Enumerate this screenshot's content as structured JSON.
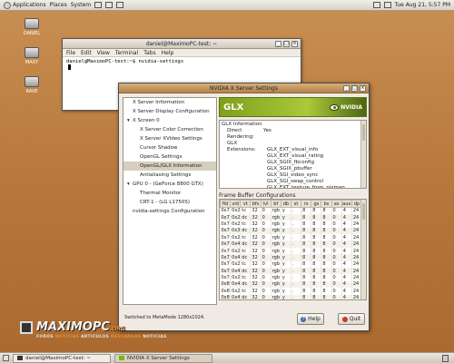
{
  "top_panel": {
    "menus": [
      "Applications",
      "Places",
      "System"
    ],
    "datetime": "Tue Aug 21,  5:57 PM"
  },
  "desktop_icons": [
    "DANIEL",
    "MAXY",
    "RAVE"
  ],
  "terminal": {
    "title": "daniel@MaximoPC-test: ~",
    "menu": [
      "File",
      "Edit",
      "View",
      "Terminal",
      "Tabs",
      "Help"
    ],
    "command_line": "daniel@MaximoPC-test:~$ nvidia-settings"
  },
  "nvidia": {
    "title": "NVIDIA X Server Settings",
    "nav": [
      {
        "label": "X Server Information",
        "level": 0,
        "expander": ""
      },
      {
        "label": "X Server Display Configuration",
        "level": 0,
        "expander": ""
      },
      {
        "label": "X Screen 0",
        "level": 0,
        "expander": "▾"
      },
      {
        "label": "X Server Color Correction",
        "level": 1,
        "expander": ""
      },
      {
        "label": "X Server XVideo Settings",
        "level": 1,
        "expander": ""
      },
      {
        "label": "Cursor Shadow",
        "level": 1,
        "expander": ""
      },
      {
        "label": "OpenGL Settings",
        "level": 1,
        "expander": ""
      },
      {
        "label": "OpenGL/GLX Information",
        "level": 1,
        "expander": "",
        "selected": true
      },
      {
        "label": "Antialiasing Settings",
        "level": 1,
        "expander": ""
      },
      {
        "label": "GPU 0 - (GeForce 8800 GTX)",
        "level": 0,
        "expander": "▾"
      },
      {
        "label": "Thermal Monitor",
        "level": 1,
        "expander": ""
      },
      {
        "label": "CRT-1 - (LG L1750S)",
        "level": 1,
        "expander": ""
      },
      {
        "label": "nvidia-settings Configuration",
        "level": 0,
        "expander": ""
      }
    ],
    "banner_title": "GLX",
    "banner_brand": "NVIDIA",
    "glx": {
      "heading": "GLX Information",
      "direct_rendering_label": "Direct Rendering:",
      "direct_rendering_value": "Yes",
      "extensions_label": "GLX Extensions:",
      "extensions": [
        "GLX_EXT_visual_info",
        "GLX_EXT_visual_rating",
        "GLX_SGIX_fbconfig",
        "GLX_SGIX_pbuffer",
        "GLX_SGI_video_sync",
        "GLX_SGI_swap_control",
        "GLX_EXT_texture_from_pixmap",
        "GLX_ARB_multisample"
      ]
    },
    "fbc": {
      "heading": "Frame Buffer Configurations",
      "columns": [
        "fid",
        "vid",
        "vt",
        "bfs",
        "lvl",
        "bf",
        "db",
        "st",
        "rs",
        "gs",
        "bs",
        "as",
        "aux",
        "dp"
      ],
      "rows": [
        [
          "0x75",
          "0x21",
          "tc",
          "32",
          "0",
          "rgb",
          "y",
          ".",
          "8",
          "8",
          "8",
          "0",
          "4",
          "24"
        ],
        [
          "0x76",
          "0x22",
          "dc",
          "32",
          "0",
          "rgb",
          "y",
          ".",
          "8",
          "8",
          "8",
          "0",
          "4",
          "24"
        ],
        [
          "0x77",
          "0x24",
          "tc",
          "32",
          "0",
          "rgb",
          "y",
          ".",
          "8",
          "8",
          "8",
          "0",
          "4",
          "24"
        ],
        [
          "0x78",
          "0x3f",
          "dc",
          "32",
          "0",
          "rgb",
          "y",
          ".",
          "8",
          "8",
          "8",
          "0",
          "4",
          "24"
        ],
        [
          "0x79",
          "0x25",
          "tc",
          "32",
          "0",
          "rgb",
          "y",
          ".",
          "8",
          "8",
          "8",
          "0",
          "4",
          "24"
        ],
        [
          "0x7a",
          "0x40",
          "dc",
          "32",
          "0",
          "rgb",
          "y",
          ".",
          "8",
          "8",
          "8",
          "0",
          "4",
          "24"
        ],
        [
          "0x7b",
          "0x26",
          "tc",
          "32",
          "0",
          "rgb",
          "y",
          ".",
          "8",
          "8",
          "8",
          "0",
          "4",
          "24"
        ],
        [
          "0x7c",
          "0x41",
          "dc",
          "32",
          "0",
          "rgb",
          "y",
          ".",
          "8",
          "8",
          "8",
          "0",
          "4",
          "24"
        ],
        [
          "0x7d",
          "0x27",
          "tc",
          "32",
          "0",
          "rgb",
          "y",
          ".",
          "8",
          "8",
          "8",
          "0",
          "4",
          "24"
        ],
        [
          "0x7e",
          "0x42",
          "dc",
          "32",
          "0",
          "rgb",
          "y",
          ".",
          "8",
          "8",
          "8",
          "0",
          "4",
          "24"
        ],
        [
          "0x7f",
          "0x28",
          "tc",
          "32",
          "0",
          "rgb",
          "y",
          ".",
          "8",
          "8",
          "8",
          "0",
          "4",
          "24"
        ],
        [
          "0x80",
          "0x43",
          "dc",
          "32",
          "0",
          "rgb",
          "y",
          ".",
          "8",
          "8",
          "8",
          "0",
          "4",
          "24"
        ],
        [
          "0x81",
          "0x29",
          "tc",
          "32",
          "0",
          "rgb",
          "y",
          ".",
          "8",
          "8",
          "8",
          "0",
          "4",
          "24"
        ],
        [
          "0x82",
          "0x44",
          "dc",
          "32",
          "0",
          "rgb",
          "y",
          ".",
          "8",
          "8",
          "8",
          "0",
          "4",
          "24"
        ],
        [
          "0x83",
          "0x2a",
          "tc",
          "32",
          "0",
          "rgb",
          "y",
          ".",
          "8",
          "8",
          "8",
          "0",
          "4",
          "24"
        ]
      ]
    },
    "status": "Switched to MetaMode 1280x1024.",
    "help_label": "Help",
    "quit_label": "Quit"
  },
  "watermark": {
    "brand": "MAXIMOPC",
    "suffix": ".ORG",
    "tagline_parts": [
      "FOROS",
      "NOTICIAS",
      "ARTICULOS",
      "DESCARGAS",
      "NOTICIAS"
    ]
  },
  "taskbar": {
    "items": [
      "daniel@MaximoPC-test: ~",
      "NVIDIA X Server Settings"
    ]
  },
  "colors": {
    "nvidia_green": "#76b900",
    "desktop_orange": "#b97a3e"
  }
}
